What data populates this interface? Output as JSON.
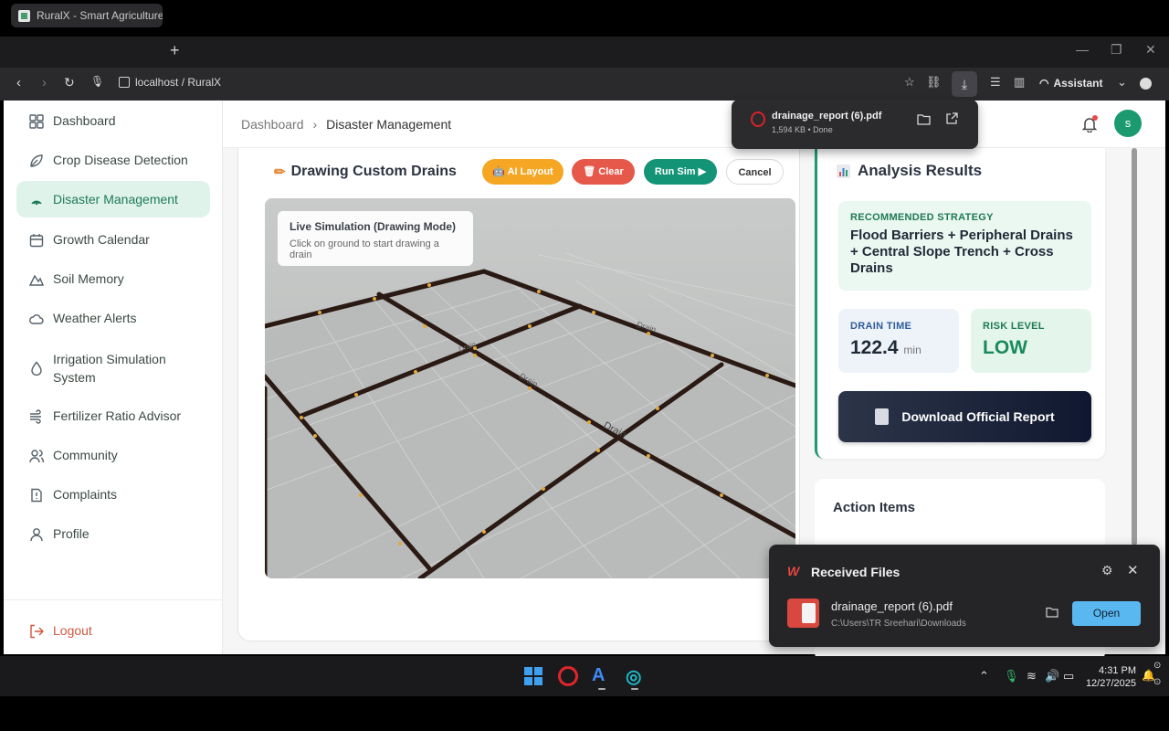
{
  "browser": {
    "tab_title": "RuralX - Smart Agriculture Ec",
    "url": "localhost / RuralX",
    "assistant_label": "Assistant"
  },
  "download_popup": {
    "file_name": "drainage_report (6).pdf",
    "meta": "1,594 KB • Done"
  },
  "sidebar": {
    "items": [
      {
        "label": "Dashboard",
        "icon": "grid-icon"
      },
      {
        "label": "Crop Disease Detection",
        "icon": "leaf-icon"
      },
      {
        "label": "Disaster Management",
        "icon": "signal-icon"
      },
      {
        "label": "Growth Calendar",
        "icon": "calendar-icon"
      },
      {
        "label": "Soil Memory",
        "icon": "mountain-icon"
      },
      {
        "label": "Weather Alerts",
        "icon": "cloud-icon"
      },
      {
        "label": "Irrigation Simulation System",
        "icon": "drop-icon"
      },
      {
        "label": "Fertilizer Ratio Advisor",
        "icon": "wind-icon"
      },
      {
        "label": "Community",
        "icon": "users-icon"
      },
      {
        "label": "Complaints",
        "icon": "alert-icon"
      },
      {
        "label": "Profile",
        "icon": "user-icon"
      }
    ],
    "logout": "Logout"
  },
  "header": {
    "breadcrumb_root": "Dashboard",
    "breadcrumb_current": "Disaster Management",
    "avatar_letter": "s"
  },
  "drawing": {
    "title": "Drawing Custom Drains",
    "btn_ai_layout": "AI Layout",
    "btn_clear": "Clear",
    "btn_run_sim": "Run Sim ▶",
    "btn_cancel": "Cancel",
    "sim_title": "Live Simulation (Drawing Mode)",
    "sim_subtitle": "Click on ground to start drawing a drain",
    "drain_labels": [
      "Drain",
      "Drain",
      "Drain",
      "Drain"
    ]
  },
  "analysis": {
    "title": "Analysis Results",
    "strategy_label": "RECOMMENDED STRATEGY",
    "strategy_text": "Flood Barriers + Peripheral Drains + Central Slope Trench + Cross Drains",
    "drain_time_label": "DRAIN TIME",
    "drain_time_value": "122.4",
    "drain_time_unit": "min",
    "risk_label": "RISK LEVEL",
    "risk_value": "LOW",
    "download_label": "Download Official Report"
  },
  "action_items": {
    "title": "Action Items"
  },
  "received_files": {
    "title": "Received Files",
    "file_name": "drainage_report (6).pdf",
    "file_path": "C:\\Users\\TR Sreehari\\Downloads",
    "open_label": "Open"
  },
  "taskbar": {
    "time": "4:31 PM",
    "date": "12/27/2025"
  },
  "colors": {
    "accent_green": "#1f9a70",
    "ai_layout": "#f5a623",
    "clear": "#e5584a",
    "run_sim": "#149477"
  }
}
